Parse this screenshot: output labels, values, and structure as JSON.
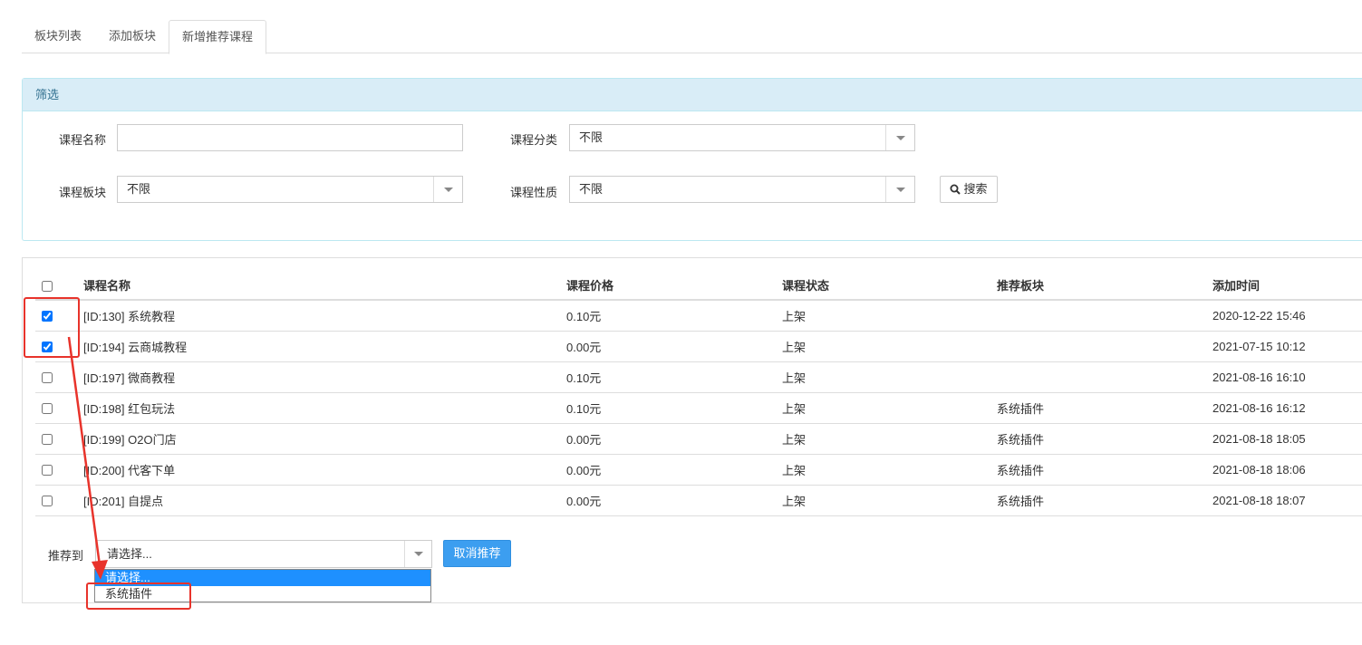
{
  "tabs": [
    {
      "label": "板块列表"
    },
    {
      "label": "添加板块"
    },
    {
      "label": "新增推荐课程"
    }
  ],
  "filter": {
    "title": "筛选",
    "course_name_label": "课程名称",
    "course_name_value": "",
    "category_label": "课程分类",
    "category_value": "不限",
    "block_label": "课程板块",
    "block_value": "不限",
    "nature_label": "课程性质",
    "nature_value": "不限",
    "search_label": "搜索"
  },
  "table": {
    "headers": [
      "课程名称",
      "课程价格",
      "课程状态",
      "推荐板块",
      "添加时间"
    ],
    "rows": [
      {
        "checked": true,
        "name": "[ID:130] 系统教程",
        "price": "0.10元",
        "status": "上架",
        "block": "",
        "time": "2020-12-22 15:46"
      },
      {
        "checked": true,
        "name": "[ID:194] 云商城教程",
        "price": "0.00元",
        "status": "上架",
        "block": "",
        "time": "2021-07-15 10:12"
      },
      {
        "checked": false,
        "name": "[ID:197] 微商教程",
        "price": "0.10元",
        "status": "上架",
        "block": "",
        "time": "2021-08-16 16:10"
      },
      {
        "checked": false,
        "name": "[ID:198] 红包玩法",
        "price": "0.10元",
        "status": "上架",
        "block": "系统插件",
        "time": "2021-08-16 16:12"
      },
      {
        "checked": false,
        "name": "[ID:199] O2O门店",
        "price": "0.00元",
        "status": "上架",
        "block": "系统插件",
        "time": "2021-08-18 18:05"
      },
      {
        "checked": false,
        "name": "[ID:200] 代客下单",
        "price": "0.00元",
        "status": "上架",
        "block": "系统插件",
        "time": "2021-08-18 18:06"
      },
      {
        "checked": false,
        "name": "[ID:201] 自提点",
        "price": "0.00元",
        "status": "上架",
        "block": "系统插件",
        "time": "2021-08-18 18:07"
      }
    ]
  },
  "recommend": {
    "label": "推荐到",
    "value": "请选择...",
    "cancel_label": "取消推荐",
    "options": [
      "请选择...",
      "系统插件"
    ]
  },
  "colors": {
    "accent": "#3c9ef0",
    "annotation": "#e8332b",
    "panel_head": "#d9edf7"
  }
}
